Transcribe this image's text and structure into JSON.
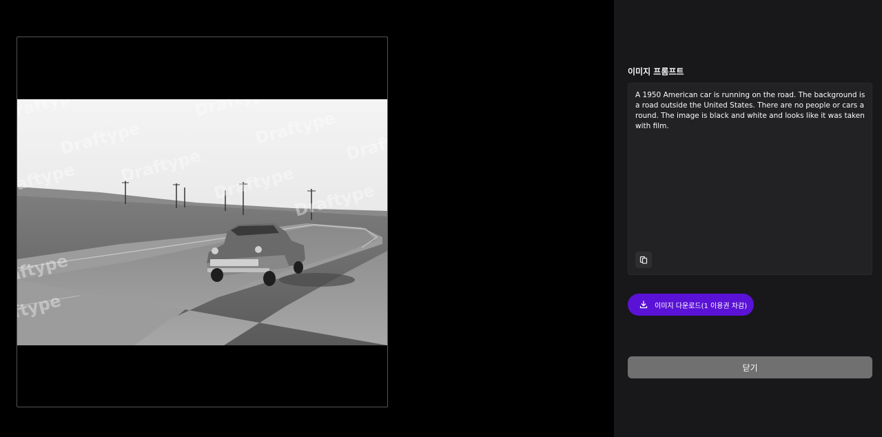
{
  "image": {
    "watermark": "Draftype"
  },
  "panel": {
    "prompt_title": "이미지 프롬프트",
    "prompt_text": "A 1950 American car is running on the road. The background is a road outside the United States. There are no people or cars around. The image is black and white and looks like it was taken with film.",
    "copy_icon": "copy-icon",
    "download_label": "이미지 다운로드(1 이용권 차감)",
    "download_icon": "download-icon",
    "close_label": "닫기"
  },
  "colors": {
    "accent": "#5a12d6",
    "panel_bg": "#18181a",
    "close_bg": "#707070"
  }
}
